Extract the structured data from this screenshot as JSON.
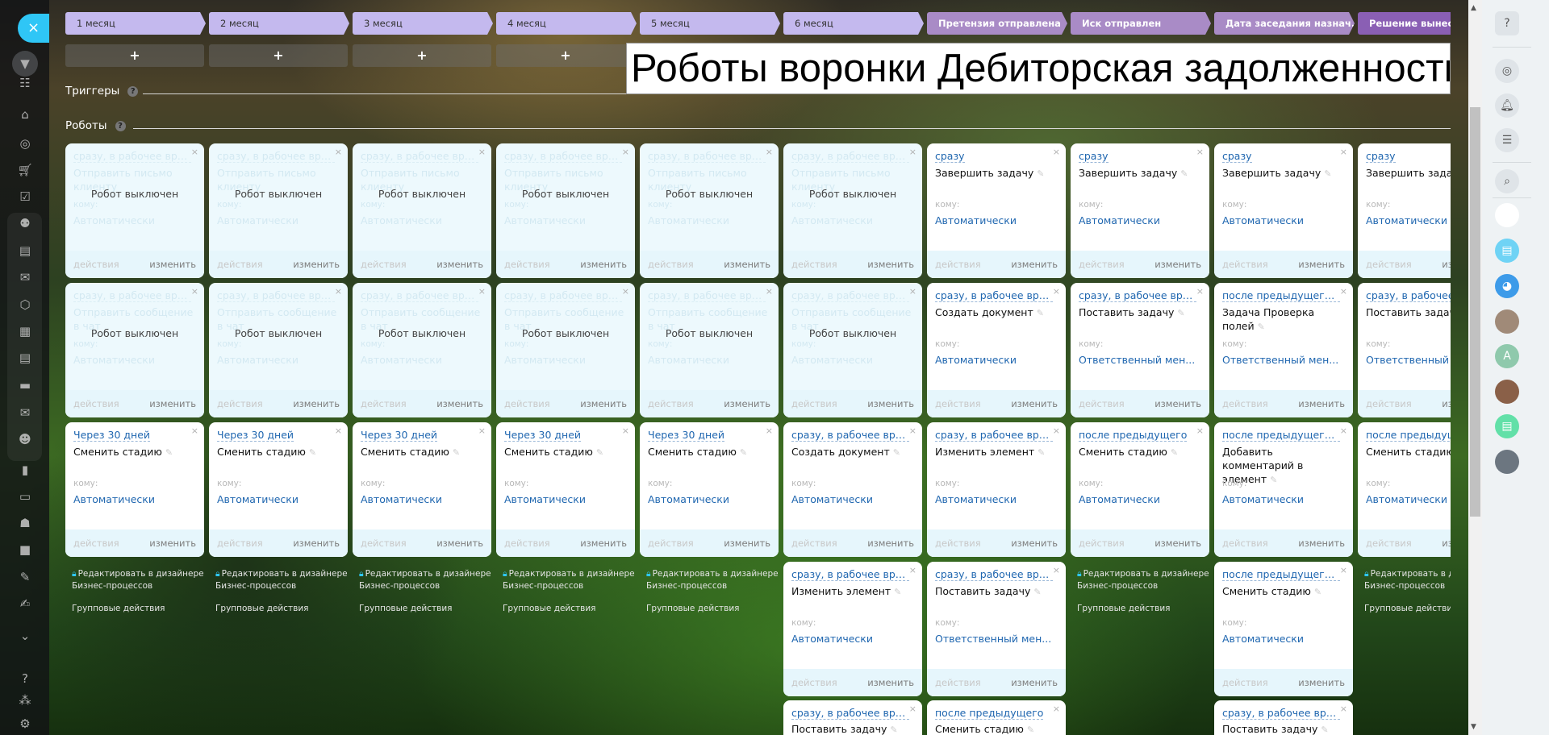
{
  "sidebar": {
    "close_icon": "×",
    "items": [
      "filter-icon",
      "calendar-list-icon",
      "warehouse-icon",
      "target-icon",
      "cart-icon",
      "task-icon",
      "sites-icon",
      "feed-icon",
      "chat-icon",
      "hexagon-icon",
      "calendar-icon",
      "document-icon",
      "drive-icon",
      "mail-icon",
      "group-icon",
      "chart-icon",
      "contact-card-icon",
      "robot-icon",
      "box-icon",
      "edit-list-icon",
      "signature-icon",
      "chevron-down-icon",
      "help-icon",
      "network-icon",
      "gear-icon"
    ]
  },
  "stages": [
    "1 месяц",
    "2 месяц",
    "3 месяц",
    "4 месяц",
    "5 месяц",
    "6 месяц",
    "Претензия отправлена",
    "Иск отправлен",
    "Дата заседания назнач...",
    "Решение вынесен"
  ],
  "plus_label": "+",
  "overlay_title": "Роботы воронки Дебиторская задолженность",
  "sections": {
    "triggers": "Триггеры",
    "robots": "Роботы",
    "help": "?"
  },
  "labels": {
    "to": "кому:",
    "actions": "действия",
    "edit": "изменить",
    "disabled": "Робот выключен",
    "close": "×",
    "pencil": "✎",
    "lock_line1": "Редактировать в дизайнере",
    "lock_line2": "Бизнес-процессов",
    "group_actions": "Групповые действия"
  },
  "columns": [
    {
      "robots": [
        {
          "kind": "off",
          "time": "сразу, в рабочее время",
          "title": "Отправить письмо клиенту",
          "to": "Автоматически"
        },
        {
          "kind": "off",
          "time": "сразу, в рабочее время",
          "title": "Отправить сообщение в чат",
          "to": "Автоматически"
        },
        {
          "kind": "on",
          "time": "Через 30 дней",
          "title": "Сменить стадию",
          "to": "Автоматически"
        },
        {
          "kind": "lock"
        }
      ]
    },
    {
      "robots": [
        {
          "kind": "off",
          "time": "сразу, в рабочее время",
          "title": "Отправить письмо клиенту",
          "to": "Автоматически"
        },
        {
          "kind": "off",
          "time": "сразу, в рабочее время",
          "title": "Отправить сообщение в чат",
          "to": "Автоматически"
        },
        {
          "kind": "on",
          "time": "Через 30 дней",
          "title": "Сменить стадию",
          "to": "Автоматически"
        },
        {
          "kind": "lock"
        }
      ]
    },
    {
      "robots": [
        {
          "kind": "off",
          "time": "сразу, в рабочее время",
          "title": "Отправить письмо клиенту",
          "to": "Автоматически"
        },
        {
          "kind": "off",
          "time": "сразу, в рабочее время",
          "title": "Отправить сообщение в чат",
          "to": "Автоматически"
        },
        {
          "kind": "on",
          "time": "Через 30 дней",
          "title": "Сменить стадию",
          "to": "Автоматически"
        },
        {
          "kind": "lock"
        }
      ]
    },
    {
      "robots": [
        {
          "kind": "off",
          "time": "сразу, в рабочее время",
          "title": "Отправить письмо клиенту",
          "to": "Автоматически"
        },
        {
          "kind": "off",
          "time": "сразу, в рабочее время",
          "title": "Отправить сообщение в чат",
          "to": "Автоматически"
        },
        {
          "kind": "on",
          "time": "Через 30 дней",
          "title": "Сменить стадию",
          "to": "Автоматически"
        },
        {
          "kind": "lock"
        }
      ]
    },
    {
      "robots": [
        {
          "kind": "off",
          "time": "сразу, в рабочее время",
          "title": "Отправить письмо клиенту",
          "to": "Автоматически"
        },
        {
          "kind": "off",
          "time": "сразу, в рабочее время",
          "title": "Отправить сообщение в чат",
          "to": "Автоматически"
        },
        {
          "kind": "on",
          "time": "Через 30 дней",
          "title": "Сменить стадию",
          "to": "Автоматически"
        },
        {
          "kind": "lock"
        }
      ]
    },
    {
      "robots": [
        {
          "kind": "off",
          "time": "сразу, в рабочее время",
          "title": "Отправить письмо клиенту",
          "to": "Автоматически"
        },
        {
          "kind": "off",
          "time": "сразу, в рабочее время",
          "title": "Отправить сообщение в чат",
          "to": "Автоматически"
        },
        {
          "kind": "on",
          "time": "сразу, в рабочее врем...",
          "title": "Создать документ",
          "to": "Автоматически"
        },
        {
          "kind": "on",
          "time": "сразу, в рабочее врем...",
          "title": "Изменить элемент",
          "to": "Автоматически"
        },
        {
          "kind": "on",
          "time": "сразу, в рабочее врем...",
          "title": "Поставить задачу",
          "to": ""
        }
      ]
    },
    {
      "robots": [
        {
          "kind": "on",
          "time": "сразу",
          "title": "Завершить задачу",
          "to": "Автоматически"
        },
        {
          "kind": "on",
          "time": "сразу, в рабочее врем...",
          "title": "Создать документ",
          "to": "Автоматически"
        },
        {
          "kind": "on",
          "time": "сразу, в рабочее врем...",
          "title": "Изменить элемент",
          "to": "Автоматически"
        },
        {
          "kind": "on",
          "time": "сразу, в рабочее врем...",
          "title": "Поставить задачу",
          "to": "Ответственный мен..."
        },
        {
          "kind": "on",
          "time": "после предыдущего",
          "title": "Сменить стадию",
          "to": ""
        }
      ]
    },
    {
      "robots": [
        {
          "kind": "on",
          "time": "сразу",
          "title": "Завершить задачу",
          "to": "Автоматически"
        },
        {
          "kind": "on",
          "time": "сразу, в рабочее врем...",
          "title": "Поставить задачу",
          "to": "Ответственный мен..."
        },
        {
          "kind": "on",
          "time": "после предыдущего",
          "title": "Сменить стадию",
          "to": "Автоматически"
        },
        {
          "kind": "lock"
        }
      ]
    },
    {
      "robots": [
        {
          "kind": "on",
          "time": "сразу",
          "title": "Завершить задачу",
          "to": "Автоматически"
        },
        {
          "kind": "on",
          "time": "после предыдущего, п...",
          "title": "Задача Проверка полей",
          "to": "Ответственный мен..."
        },
        {
          "kind": "on",
          "time": "после предыдущего, п...",
          "title": "Добавить комментарий в элемент",
          "to": "Автоматически"
        },
        {
          "kind": "on",
          "time": "после предыдущего, п...",
          "title": "Сменить стадию",
          "to": "Автоматически"
        },
        {
          "kind": "on",
          "time": "сразу, в рабочее врем...",
          "title": "Поставить задачу",
          "to": ""
        }
      ]
    },
    {
      "robots": [
        {
          "kind": "on",
          "time": "сразу",
          "title": "Завершить задачу",
          "to": "Автоматически"
        },
        {
          "kind": "on",
          "time": "сразу, в рабочее врем...",
          "title": "Поставить задачу",
          "to": "Ответственный мен..."
        },
        {
          "kind": "on",
          "time": "после предыдущего",
          "title": "Сменить стадию",
          "to": "Автоматически"
        },
        {
          "kind": "lock"
        }
      ]
    }
  ],
  "right_rail": {
    "help": "?",
    "avatar_letter": "A",
    "items": [
      "help-icon",
      "copilot-icon",
      "bell-icon",
      "chat-search-icon",
      "search-icon",
      "robot-avatar",
      "chat-bot-avatar",
      "dog-avatar",
      "user-avatar-1",
      "user-avatar-a",
      "user-avatar-2",
      "news-avatar",
      "user-avatar-3"
    ]
  }
}
